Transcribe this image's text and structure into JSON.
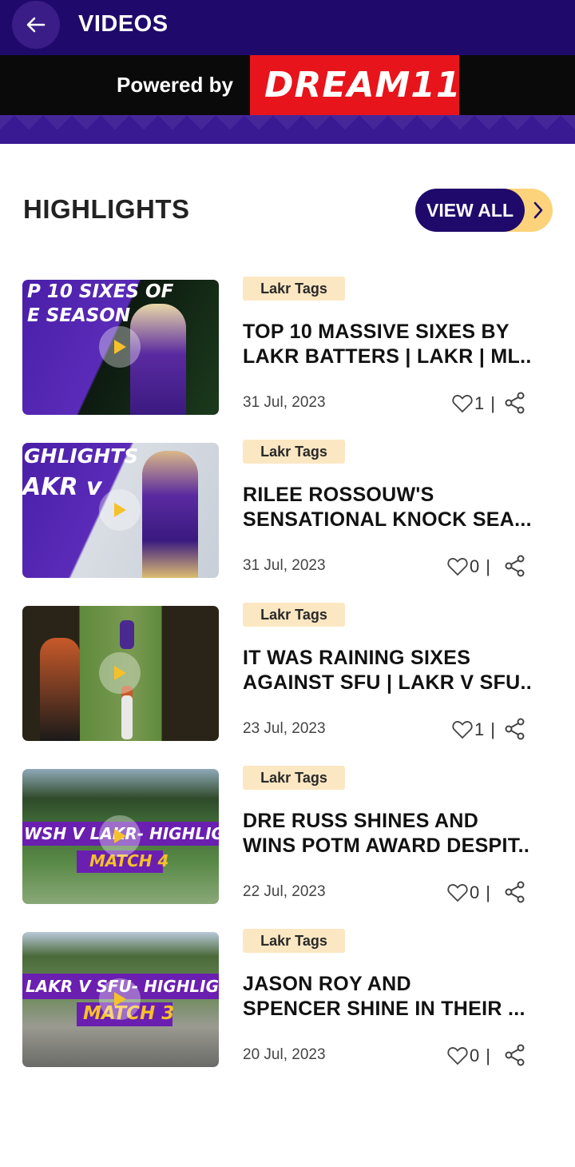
{
  "header": {
    "title": "VIDEOS",
    "back_icon": "arrow-left-icon"
  },
  "sponsor": {
    "powered_by": "Powered by",
    "brand": "DREAM11",
    "brand_color": "#e8141c"
  },
  "section": {
    "title": "HIGHLIGHTS",
    "view_all": "VIEW ALL"
  },
  "colors": {
    "primary": "#1f0a6b",
    "accent": "#fcd37a",
    "tag_bg": "#fbe7c2"
  },
  "videos": [
    {
      "tag": "Lakr Tags",
      "title_line1": "TOP 10 MASSIVE SIXES BY",
      "title_line2": "LAKR BATTERS | LAKR | ML...",
      "date": "31 Jul, 2023",
      "likes": "1",
      "thumb_text1": "P 10 SIXES OF",
      "thumb_text2": "E SEASON"
    },
    {
      "tag": "Lakr Tags",
      "title_line1": "RILEE ROSSOUW'S",
      "title_line2": "SENSATIONAL KNOCK SEA...",
      "date": "31 Jul, 2023",
      "likes": "0",
      "thumb_text1": "GHLIGHTS",
      "thumb_text2": "AKR v"
    },
    {
      "tag": "Lakr Tags",
      "title_line1": "IT WAS RAINING SIXES",
      "title_line2": "AGAINST SFU | LAKR V SFU...",
      "date": "23 Jul, 2023",
      "likes": "1"
    },
    {
      "tag": "Lakr Tags",
      "title_line1": "DRE RUSS SHINES AND",
      "title_line2": "WINS POTM AWARD DESPIT...",
      "date": "22 Jul, 2023",
      "likes": "0",
      "thumb_text1": "WSH V LAKR- HIGHLIGHTS",
      "thumb_text2": "MATCH 4"
    },
    {
      "tag": "Lakr Tags",
      "title_line1": "JASON ROY AND",
      "title_line2": "SPENCER SHINE IN THEIR ...",
      "date": "20 Jul, 2023",
      "likes": "0",
      "thumb_text1": "LAKR V SFU- HIGHLIGHTS",
      "thumb_text2": "MATCH 3"
    }
  ]
}
